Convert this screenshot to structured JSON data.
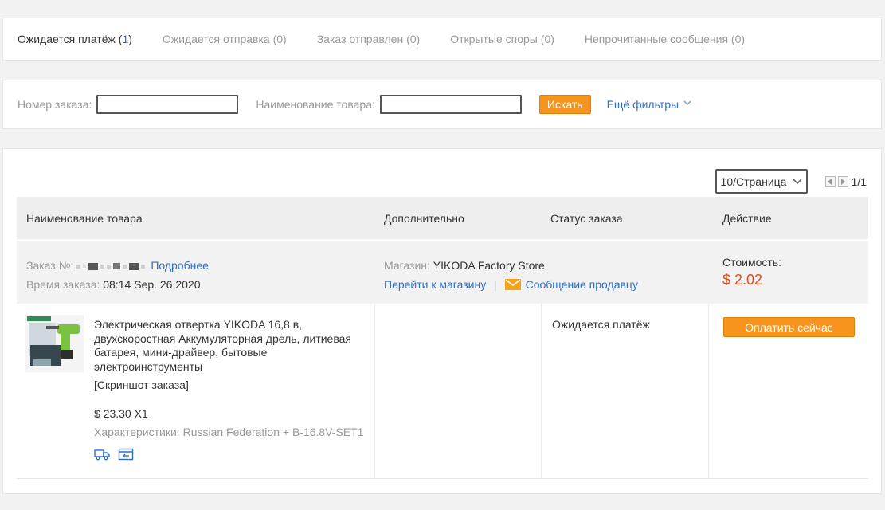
{
  "tabs": [
    {
      "label": "Ожидается платёж",
      "count": "1",
      "active": true
    },
    {
      "label": "Ожидается отправка",
      "count": "0",
      "active": false
    },
    {
      "label": "Заказ отправлен",
      "count": "0",
      "active": false
    },
    {
      "label": "Открытые споры",
      "count": "0",
      "active": false
    },
    {
      "label": "Непрочитанные сообщения",
      "count": "0",
      "active": false
    }
  ],
  "filters": {
    "order_number_label": "Номер заказа:",
    "order_number_value": "",
    "product_name_label": "Наименование товара:",
    "product_name_value": "",
    "search_label": "Искать",
    "more_filters_label": "Ещё фильтры"
  },
  "pager": {
    "per_page": "10/Страница",
    "page_count": "1/1"
  },
  "table_headers": {
    "product": "Наименование товара",
    "additional": "Дополнительно",
    "status": "Статус заказа",
    "action": "Действие"
  },
  "order": {
    "number_label": "Заказ №:",
    "details_link": "Подробнее",
    "time_label": "Время заказа:",
    "time_value": "08:14 Sep. 26 2020",
    "store_label": "Магазин:",
    "store_name": "YIKODA Factory Store",
    "go_to_store": "Перейти к магазину",
    "message_seller": "Сообщение продавцу",
    "cost_label": "Стоимость:",
    "cost_value": "$ 2.02",
    "product_title": "Электрическая отвертка YIKODA 16,8 в, двухскоростная Аккумуляторная дрель, литиевая батарея, мини-драйвер, бытовые электроинструменты",
    "snapshot": "[Скриншот заказа]",
    "unit_price": "$ 23.30 X1",
    "specs": "Характеристики: Russian Federation + B-16.8V-SET1",
    "status": "Ожидается платёж",
    "pay_now": "Оплатить сейчас"
  },
  "colors": {
    "accent_orange": "#f7941d",
    "link_blue": "#2a6fc9",
    "price_red": "#e64a19"
  }
}
